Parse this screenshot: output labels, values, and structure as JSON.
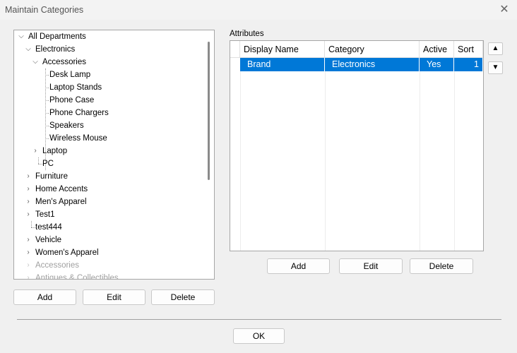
{
  "window": {
    "title": "Maintain Categories",
    "close_glyph": "✕"
  },
  "tree": {
    "nodes": [
      {
        "label": "All Departments",
        "expanded": true
      },
      {
        "label": "Electronics",
        "expanded": true
      },
      {
        "label": "Accessories",
        "expanded": true
      },
      {
        "label": "Desk Lamp"
      },
      {
        "label": "Laptop Stands"
      },
      {
        "label": "Phone Case"
      },
      {
        "label": "Phone Chargers"
      },
      {
        "label": "Speakers"
      },
      {
        "label": "Wireless Mouse"
      },
      {
        "label": "Laptop",
        "expanded": false
      },
      {
        "label": "PC"
      },
      {
        "label": "Furniture",
        "expanded": false
      },
      {
        "label": "Home Accents",
        "expanded": false
      },
      {
        "label": "Men's Apparel",
        "expanded": false
      },
      {
        "label": "Test1",
        "expanded": false
      },
      {
        "label": "test444"
      },
      {
        "label": "Vehicle",
        "expanded": false
      },
      {
        "label": "Women's Apparel",
        "expanded": false
      },
      {
        "label": "Accessories",
        "expanded": false,
        "disabled": true
      },
      {
        "label": "Antiques & Collectibles",
        "expanded": false,
        "disabled": true
      }
    ],
    "buttons": {
      "add": "Add",
      "edit": "Edit",
      "delete": "Delete"
    }
  },
  "attributes": {
    "label": "Attributes",
    "columns": [
      "Display Name",
      "Category",
      "Active",
      "Sort"
    ],
    "rows": [
      {
        "display_name": "Brand",
        "category": "Electronics",
        "active": "Yes",
        "sort": "1",
        "selected": true
      }
    ],
    "buttons": {
      "add": "Add",
      "edit": "Edit",
      "delete": "Delete"
    },
    "move_up_glyph": "▲",
    "move_down_glyph": "▼"
  },
  "footer": {
    "ok": "OK"
  },
  "colors": {
    "selection": "#0078d7",
    "disabled_text": "#a0a0a0"
  }
}
